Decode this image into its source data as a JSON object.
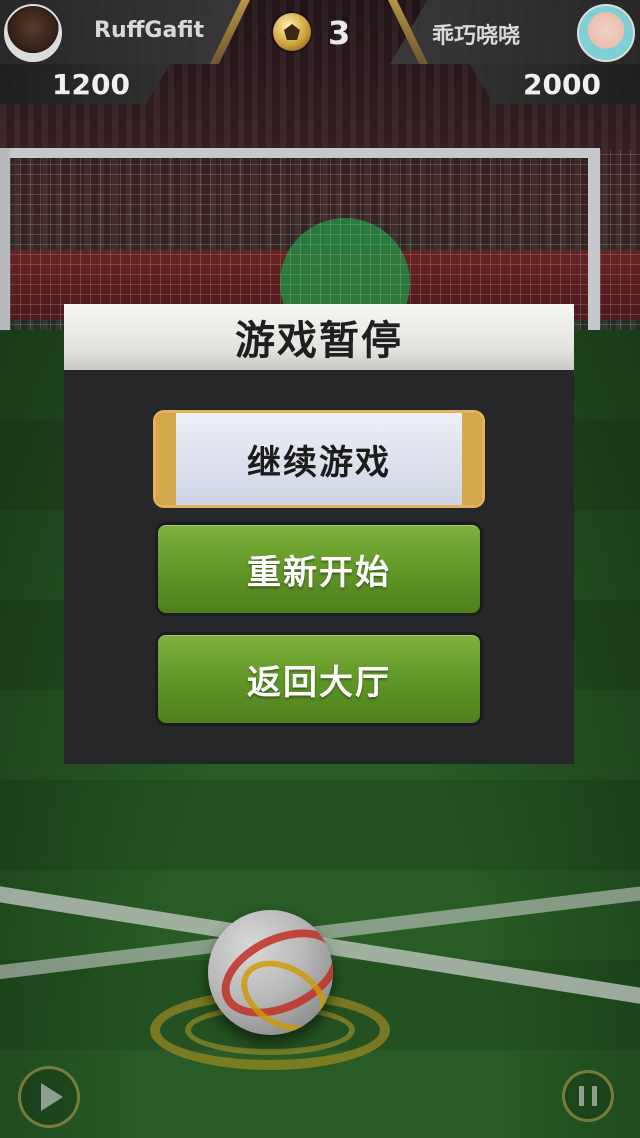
{
  "hud": {
    "player_left": {
      "name": "RuffGafit",
      "score": "1200"
    },
    "player_right": {
      "name": "乖巧哓哓",
      "score": "2000"
    },
    "round": "3"
  },
  "dialog": {
    "title": "游戏暂停",
    "continue_label": "继续游戏",
    "restart_label": "重新开始",
    "lobby_label": "返回大厅"
  },
  "icons": {
    "play": "play-icon",
    "pause": "pause-icon",
    "ball": "soccer-ball-icon"
  },
  "colors": {
    "accent_gold": "#d6a84e",
    "button_green": "#5e9526",
    "dialog_bg": "#262729"
  }
}
